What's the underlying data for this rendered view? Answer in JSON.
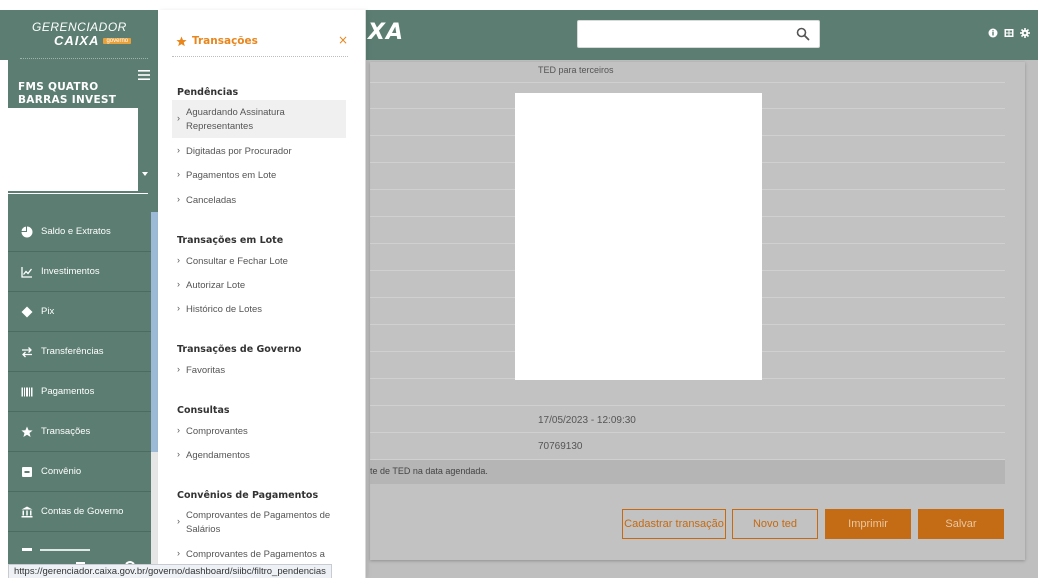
{
  "header": {
    "brand_fragment": "XA",
    "search": {
      "value": "",
      "placeholder": ""
    }
  },
  "sidebar": {
    "logo_top": "GERENCIADOR",
    "logo_caixa": "CAIXA",
    "logo_gov": "governo",
    "company": "FMS QUATRO BARRAS INVEST",
    "items": [
      {
        "label": "Saldo e Extratos",
        "icon": "pie-chart-icon"
      },
      {
        "label": "Investimentos",
        "icon": "line-chart-icon"
      },
      {
        "label": "Pix",
        "icon": "pix-icon"
      },
      {
        "label": "Transferências",
        "icon": "transfer-arrows-icon"
      },
      {
        "label": "Pagamentos",
        "icon": "barcode-icon"
      },
      {
        "label": "Transações",
        "icon": "star-icon"
      },
      {
        "label": "Convênio",
        "icon": "convenio-icon"
      },
      {
        "label": "Contas de Governo",
        "icon": "government-building-icon"
      }
    ]
  },
  "flyout": {
    "title": "Transações",
    "close": "×",
    "sections": [
      {
        "title": "Pendências",
        "items": [
          "Aguardando Assinatura Representantes",
          "Digitadas por Procurador",
          "Pagamentos em Lote",
          "Canceladas"
        ]
      },
      {
        "title": "Transações em Lote",
        "items": [
          "Consultar e Fechar Lote",
          "Autorizar Lote",
          "Histórico de Lotes"
        ]
      },
      {
        "title": "Transações de Governo",
        "items": [
          "Favoritas"
        ]
      },
      {
        "title": "Consultas",
        "items": [
          "Comprovantes",
          "Agendamentos"
        ]
      },
      {
        "title": "Convênios de Pagamentos",
        "items": [
          "Comprovantes de Pagamentos de Salários",
          "Comprovantes de Pagamentos a"
        ]
      }
    ]
  },
  "main": {
    "transfer_type": "TED para terceiros",
    "datetime": "17/05/2023 - 12:09:30",
    "code": "70769130",
    "info_text": "te de TED na data agendada.",
    "buttons": {
      "cadastrar": "Cadastrar transação",
      "novo_ted": "Novo ted",
      "imprimir": "Imprimir",
      "salvar": "Salvar"
    }
  },
  "status_url": "https://gerenciador.caixa.gov.br/governo/dashboard/siibc/filtro_pendencias",
  "colors": {
    "header_green": "#5b7d72",
    "accent_orange": "#e8861c",
    "button_orange": "#c36b15",
    "scroll_blue": "#9cb9d6"
  }
}
